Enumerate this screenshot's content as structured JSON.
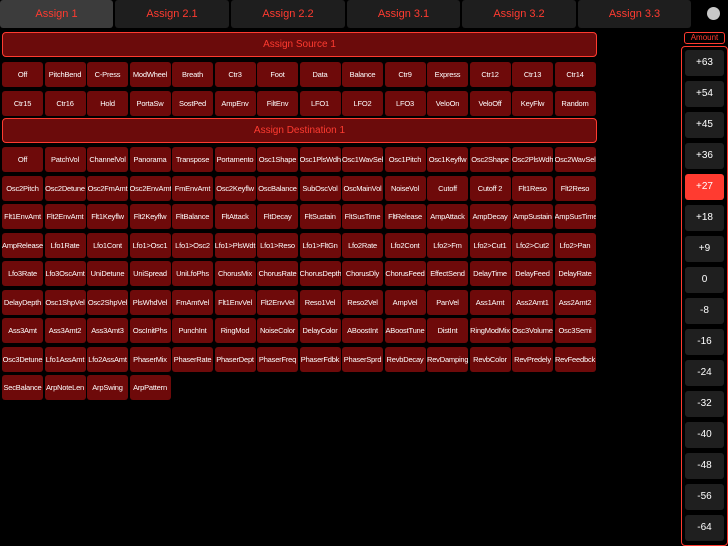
{
  "tabs": [
    "Assign 1",
    "Assign 2.1",
    "Assign 2.2",
    "Assign 3.1",
    "Assign 3.2",
    "Assign 3.3"
  ],
  "active_tab_index": 0,
  "source_header": "Assign Source 1",
  "sources": [
    "Off",
    "PitchBend",
    "C-Press",
    "ModWheel",
    "Breath",
    "Ctr3",
    "Foot",
    "Data",
    "Balance",
    "Ctr9",
    "Express",
    "Ctr12",
    "Ctr13",
    "Ctr14",
    "Ctr15",
    "Ctr16",
    "Hold",
    "PortaSw",
    "SostPed",
    "AmpEnv",
    "FiltEnv",
    "LFO1",
    "LFO2",
    "LFO3",
    "VeloOn",
    "VeloOff",
    "KeyFlw",
    "Random"
  ],
  "destination_header": "Assign Destination 1",
  "destinations": [
    "Off",
    "PatchVol",
    "ChannelVol",
    "Panorama",
    "Transpose",
    "Portamento",
    "Osc1Shape",
    "Osc1PlsWdh",
    "Osc1WavSel",
    "Osc1Pitch",
    "Osc1Keyflw",
    "Osc2Shape",
    "Osc2PlsWdh",
    "Osc2WavSel",
    "Osc2Pitch",
    "Osc2Detune",
    "Osc2FmAmt",
    "Osc2EnvAmt",
    "FmEnvAmt",
    "Osc2Keyflw",
    "OscBalance",
    "SubOscVol",
    "OscMainVol",
    "NoiseVol",
    "Cutoff",
    "Cutoff 2",
    "Flt1Reso",
    "Flt2Reso",
    "Flt1EnvAmt",
    "Flt2EnvAmt",
    "Flt1Keyflw",
    "Flt2Keyflw",
    "FltBalance",
    "FltAttack",
    "FltDecay",
    "FltSustain",
    "FltSusTime",
    "FltRelease",
    "AmpAttack",
    "AmpDecay",
    "AmpSustain",
    "AmpSusTime",
    "AmpRelease",
    "Lfo1Rate",
    "Lfo1Cont",
    "Lfo1>Osc1",
    "Lfo1>Osc2",
    "Lfo1>PlsWdt",
    "Lfo1>Reso",
    "Lfo1>FltGn",
    "Lfo2Rate",
    "Lfo2Cont",
    "Lfo2>Fm",
    "Lfo2>Cut1",
    "Lfo2>Cut2",
    "Lfo2>Pan",
    "Lfo3Rate",
    "Lfo3OscAmt",
    "UniDetune",
    "UniSpread",
    "UniLfoPhs",
    "ChorusMix",
    "ChorusRate",
    "ChorusDepth",
    "ChorusDly",
    "ChorusFeed",
    "EffectSend",
    "DelayTime",
    "DelayFeed",
    "DelayRate",
    "DelayDepth",
    "Osc1ShpVel",
    "Osc2ShpVel",
    "PlsWhdVel",
    "FmAmtVel",
    "Flt1EnvVel",
    "Flt2EnvVel",
    "Reso1Vel",
    "Reso2Vel",
    "AmpVel",
    "PanVel",
    "Ass1Amt",
    "Ass2Amt1",
    "Ass2Amt2",
    "Ass3Amt",
    "Ass3Amt2",
    "Ass3Amt3",
    "OscInitPhs",
    "PunchInt",
    "RingMod",
    "NoiseColor",
    "DelayColor",
    "ABoostInt",
    "ABoostTune",
    "DistInt",
    "RingModMix",
    "Osc3Volume",
    "Osc3Semi",
    "Osc3Detune",
    "Lfo1AssAmt",
    "Lfo2AssAmt",
    "PhaserMix",
    "PhaserRate",
    "PhaserDept",
    "PhaserFreq",
    "PhaserFdbk",
    "PhaserSprd",
    "RevbDecay",
    "RevDamping",
    "RevbColor",
    "RevPredely",
    "RevFeedbck",
    "SecBalance",
    "ArpNoteLen",
    "ArpSwing",
    "ArpPattern"
  ],
  "amount_label": "Amount",
  "amounts": [
    "+63",
    "+54",
    "+45",
    "+36",
    "+27",
    "+18",
    "+9",
    "0",
    "-8",
    "-16",
    "-24",
    "-32",
    "-40",
    "-48",
    "-56",
    "-64"
  ],
  "active_amount_index": 4,
  "colors": {
    "accent": "#ff3b30",
    "cell": "#6e0a0a",
    "header_bg": "#6b0b0b",
    "tab_active": "#3c3c3c",
    "tab": "#1e1e1e"
  }
}
